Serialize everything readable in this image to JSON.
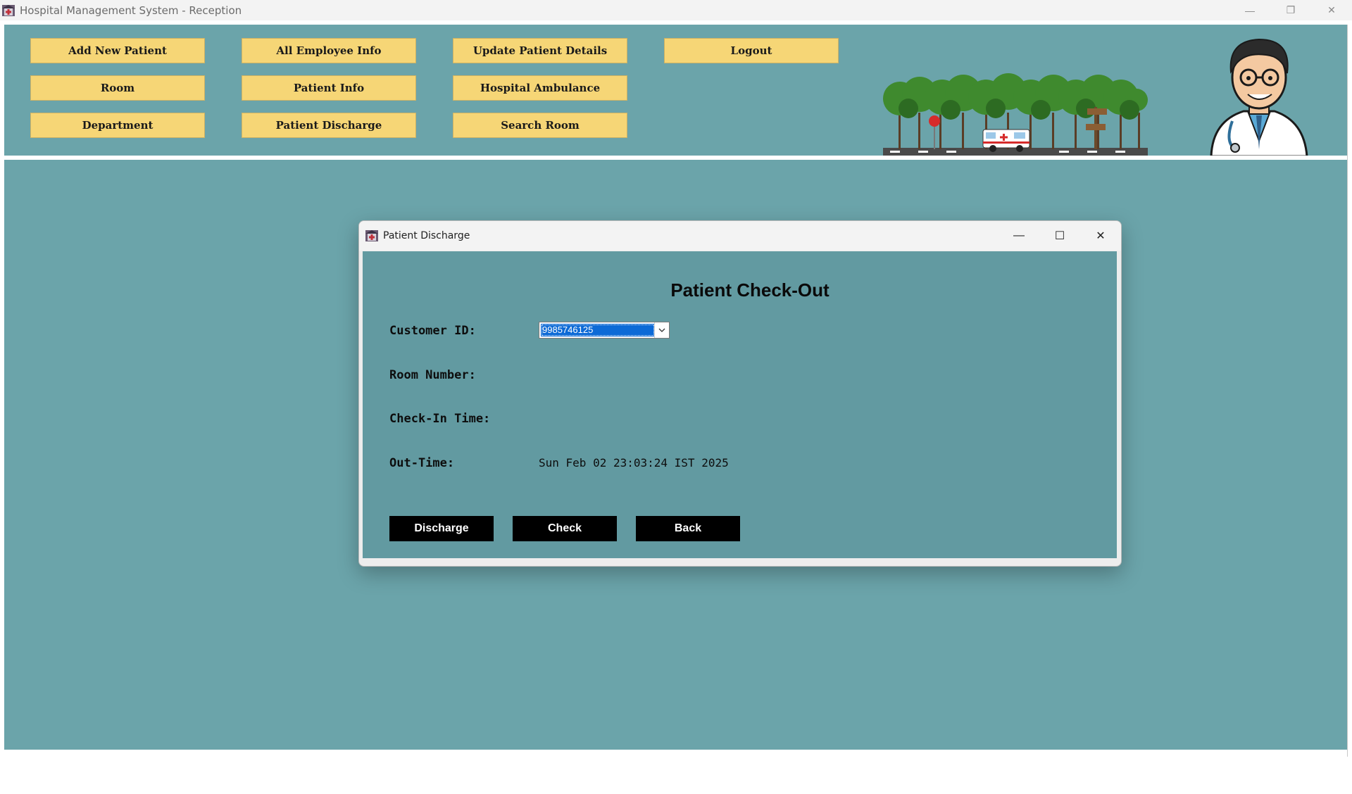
{
  "window": {
    "title": "Hospital Management System - Reception",
    "controls": {
      "minimize": "—",
      "restore": "❐",
      "close": "✕"
    }
  },
  "menu": {
    "add_new_patient": "Add New Patient",
    "all_employee_info": "All Employee Info",
    "update_patient_details": "Update Patient Details",
    "logout": "Logout",
    "room": "Room",
    "patient_info": "Patient Info",
    "hospital_ambulance": "Hospital Ambulance",
    "department": "Department",
    "patient_discharge": "Patient Discharge",
    "search_room": "Search Room"
  },
  "dialog": {
    "title": "Patient Discharge",
    "heading": "Patient Check-Out",
    "controls": {
      "minimize": "—",
      "maximize": "☐",
      "close": "✕"
    },
    "labels": {
      "customer_id": "Customer ID:",
      "room_number": "Room Number:",
      "check_in_time": "Check-In Time:",
      "out_time": "Out-Time:"
    },
    "values": {
      "customer_id": "9985746125",
      "room_number": "",
      "check_in_time": "",
      "out_time": "Sun Feb 02 23:03:24 IST 2025"
    },
    "buttons": {
      "discharge": "Discharge",
      "check": "Check",
      "back": "Back"
    }
  },
  "colors": {
    "panel_bg": "#6ba4aa",
    "dialog_bg": "#629aa1",
    "menu_button": "#f6d676",
    "action_button": "#000000",
    "selection": "#0d6ad6"
  },
  "icons": {
    "app": "hospital-app-icon",
    "combo_arrow": "chevron-down-icon"
  }
}
